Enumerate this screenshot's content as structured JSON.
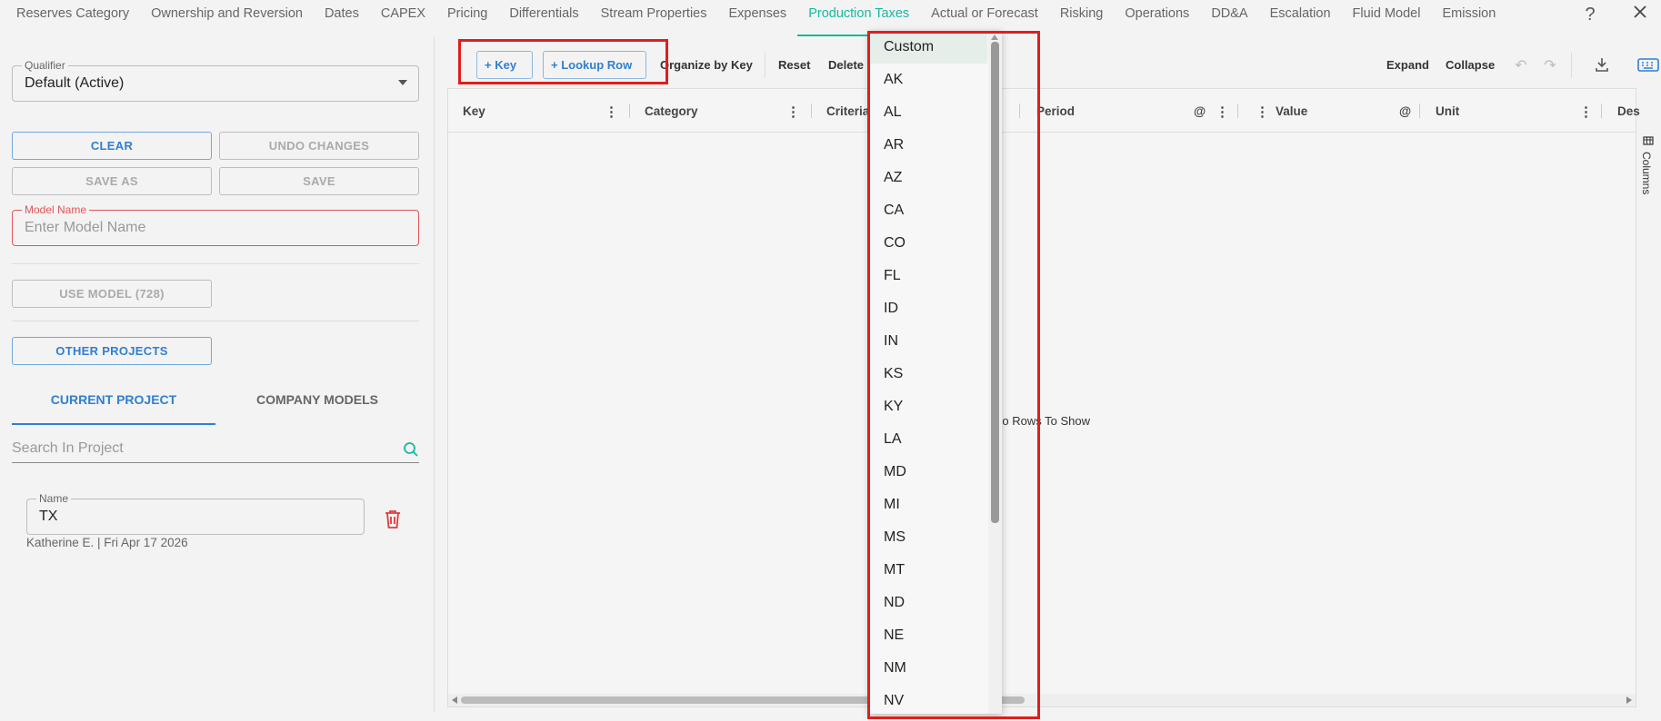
{
  "top_tabs": [
    "Reserves Category",
    "Ownership and Reversion",
    "Dates",
    "CAPEX",
    "Pricing",
    "Differentials",
    "Stream Properties",
    "Expenses",
    "Production Taxes",
    "Actual or Forecast",
    "Risking",
    "Operations",
    "DD&A",
    "Escalation",
    "Fluid Model",
    "Emission"
  ],
  "active_tab": "Production Taxes",
  "left": {
    "qualifier_label": "Qualifier",
    "qualifier_value": "Default (Active)",
    "clear": "CLEAR",
    "undo": "UNDO CHANGES",
    "save_as": "SAVE AS",
    "save": "SAVE",
    "model_name_label": "Model Name",
    "model_name_placeholder": "Enter Model Name",
    "use_model": "USE MODEL (728)",
    "other_projects": "OTHER PROJECTS",
    "tab_current": "CURRENT PROJECT",
    "tab_company": "COMPANY MODELS",
    "search_placeholder": "Search In Project",
    "name_label": "Name",
    "name_value": "TX",
    "meta": "Katherine E. | Fri Apr 17 2026"
  },
  "toolbar": {
    "key": "Key",
    "lookup_row": "Lookup Row",
    "organize": "Organize by Key",
    "reset": "Reset",
    "delete": "Delete",
    "expand": "Expand",
    "collapse": "Collapse"
  },
  "grid": {
    "headers": {
      "key": "Key",
      "category": "Category",
      "criteria": "Criteria",
      "period": "Period",
      "value": "Value",
      "unit": "Unit",
      "description": "Des"
    },
    "at_symbol": "@",
    "empty": "No Rows To Show",
    "columns_tab": "Columns"
  },
  "dropdown": {
    "options": [
      "Custom",
      "AK",
      "AL",
      "AR",
      "AZ",
      "CA",
      "CO",
      "FL",
      "ID",
      "IN",
      "KS",
      "KY",
      "LA",
      "MD",
      "MI",
      "MS",
      "MT",
      "ND",
      "NE",
      "NM",
      "NV"
    ],
    "selected": "Custom"
  },
  "colors": {
    "accent": "#17b8a0",
    "primary": "#2f7fd1",
    "highlight": "#e21d1d",
    "delete": "#e23b3b"
  }
}
